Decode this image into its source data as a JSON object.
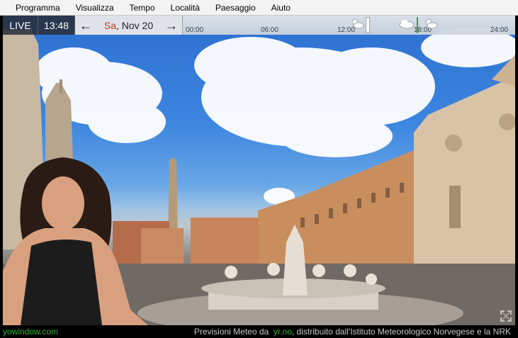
{
  "menu": {
    "items": [
      "Programma",
      "Visualizza",
      "Tempo",
      "Località",
      "Paesaggio",
      "Aiuto"
    ]
  },
  "topbar": {
    "live_label": "LIVE",
    "time": "13:48",
    "date_day": "Sa",
    "date_rest": ", Nov 20",
    "prev_arrow": "←",
    "next_arrow": "→"
  },
  "timeline": {
    "ticks": [
      "00:00",
      "06:00",
      "12:00",
      "18:00",
      "24:00"
    ],
    "icons": [
      "sun-cloud-icon",
      "cloud-icon",
      "sun-cloud-icon"
    ]
  },
  "status": {
    "brand": "yowindow.com",
    "credit_prefix": "Previsioni Meteo da",
    "credit_link": "yr.no",
    "credit_suffix": ", distribuito dall'Istituto Meteorologico Norvegese e la NRK"
  },
  "colors": {
    "accent_green": "#2fb32f",
    "date_red": "#c0392b"
  }
}
